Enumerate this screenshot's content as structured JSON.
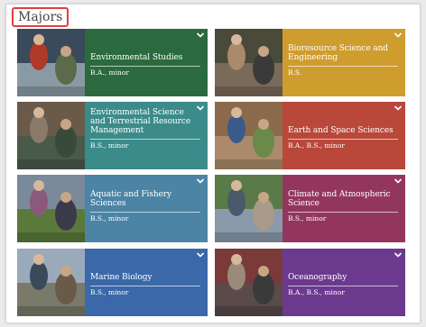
{
  "section": {
    "heading": "Majors"
  },
  "chevron_icon": "chevron-down-icon",
  "majors": [
    {
      "title": "Environmental Studies",
      "degrees": "B.A., minor",
      "color": "#2a6a3e",
      "photo": [
        "#3a4a5a",
        "#8a9aa5",
        "#b03a2a",
        "#5a6a4a"
      ]
    },
    {
      "title": "Bioresource Science and Engineering",
      "degrees": "B.S.",
      "color": "#cf9c2e",
      "photo": [
        "#4a4a3a",
        "#7a6a5a",
        "#aa8a6a",
        "#3a3a3a"
      ]
    },
    {
      "title": "Environmental Science and Terrestrial Resource Management",
      "degrees": "B.S., minor",
      "color": "#3b8b8a",
      "photo": [
        "#6a5a4a",
        "#4a5a4a",
        "#8a7a6a",
        "#3a4a3a"
      ]
    },
    {
      "title": "Earth and Space Sciences",
      "degrees": "B.A., B.S., minor",
      "color": "#b9473a",
      "photo": [
        "#8a6a4a",
        "#aa8a6a",
        "#3a5a8a",
        "#6a8a4a"
      ]
    },
    {
      "title": "Aquatic and Fishery Sciences",
      "degrees": "B.S., minor",
      "color": "#4b84a4",
      "photo": [
        "#7a8a9a",
        "#5a7a3a",
        "#8a5a7a",
        "#3a3a4a"
      ]
    },
    {
      "title": "Climate and Atmospheric Science",
      "degrees": "B.S., minor",
      "color": "#93365d",
      "photo": [
        "#5a7a4a",
        "#8a9aaa",
        "#4a5a6a",
        "#aa9a8a"
      ]
    },
    {
      "title": "Marine Biology",
      "degrees": "B.S., minor",
      "color": "#3a68a8",
      "photo": [
        "#9aaaba",
        "#7a7a6a",
        "#3a4a5a",
        "#6a5a4a"
      ]
    },
    {
      "title": "Oceanography",
      "degrees": "B.A., B.S., minor",
      "color": "#6b3a8e",
      "photo": [
        "#7a3a3a",
        "#5a4a4a",
        "#9a8a7a",
        "#3a3a3a"
      ]
    }
  ]
}
